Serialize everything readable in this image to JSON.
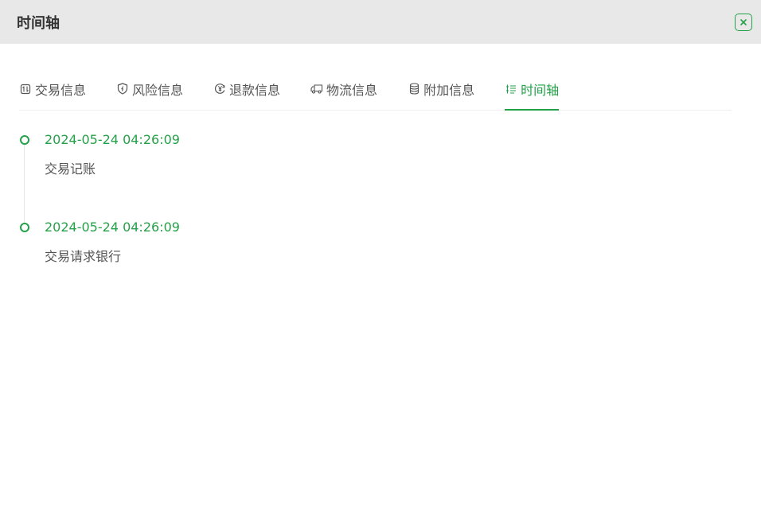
{
  "header": {
    "title": "时间轴"
  },
  "tabs": [
    {
      "label": "交易信息",
      "icon": "transaction-icon",
      "active": false
    },
    {
      "label": "风险信息",
      "icon": "shield-icon",
      "active": false
    },
    {
      "label": "退款信息",
      "icon": "yen-refund-icon",
      "active": false
    },
    {
      "label": "物流信息",
      "icon": "truck-icon",
      "active": false
    },
    {
      "label": "附加信息",
      "icon": "database-icon",
      "active": false
    },
    {
      "label": "时间轴",
      "icon": "timeline-list-icon",
      "active": true
    }
  ],
  "timeline": [
    {
      "time": "2024-05-24 04:26:09",
      "text": "交易记账"
    },
    {
      "time": "2024-05-24 04:26:09",
      "text": "交易请求银行"
    }
  ],
  "colors": {
    "accent": "#24a148",
    "header_bg": "#e8e8e8"
  }
}
